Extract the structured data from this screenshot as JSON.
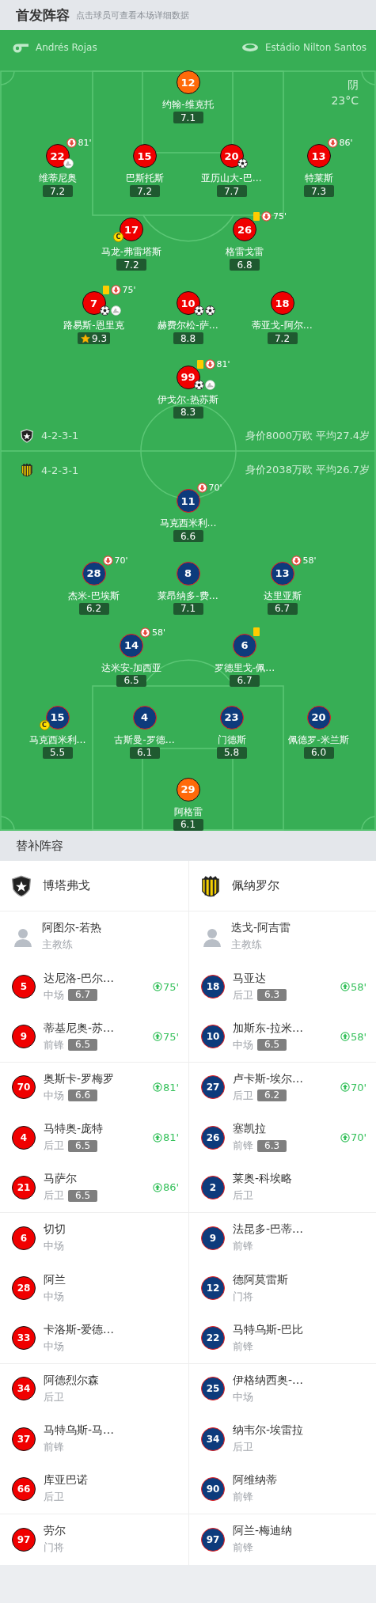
{
  "header": {
    "title": "首发阵容",
    "hint": "点击球员可查看本场详细数据"
  },
  "match_info": {
    "referee": "Andrés Rojas",
    "venue": "Estádio Nilton Santos",
    "weather": "阴",
    "temperature": "23°C"
  },
  "pitch": {
    "home": {
      "formation": "4-2-3-1",
      "summary": "身价8000万欧 平均27.4岁",
      "rows": [
        {
          "players": [
            {
              "number": "12",
              "name": "约翰-维克托",
              "rating": "7.1",
              "kind": "goalkeeper"
            }
          ]
        },
        {
          "players": [
            {
              "number": "22",
              "name": "维蒂尼奥",
              "rating": "7.2",
              "kind": "outfield",
              "events": [
                {
                  "kind": "substitution",
                  "minute": "81'"
                }
              ],
              "contributions": [
                {
                  "kind": "assist"
                }
              ]
            },
            {
              "number": "15",
              "name": "巴斯托斯",
              "rating": "7.2",
              "kind": "outfield"
            },
            {
              "number": "20",
              "name": "亚历山大-巴…",
              "rating": "7.7",
              "kind": "outfield",
              "contributions": [
                {
                  "kind": "goal"
                }
              ]
            },
            {
              "number": "13",
              "name": "特莱斯",
              "rating": "7.3",
              "kind": "outfield",
              "events": [
                {
                  "kind": "substitution",
                  "minute": "86'"
                }
              ]
            }
          ]
        },
        {
          "players": [
            {
              "number": "17",
              "name": "马龙-弗雷塔斯",
              "rating": "7.2",
              "kind": "outfield",
              "captain_mark": "C"
            },
            {
              "number": "26",
              "name": "格雷戈雷",
              "rating": "6.8",
              "kind": "outfield",
              "events": [
                {
                  "kind": "yellow_card"
                },
                {
                  "kind": "substitution",
                  "minute": "75'"
                }
              ]
            }
          ]
        },
        {
          "players": [
            {
              "number": "7",
              "name": "路易斯-恩里克",
              "rating": "9.3",
              "kind": "outfield",
              "best": true,
              "events": [
                {
                  "kind": "yellow_card"
                },
                {
                  "kind": "substitution",
                  "minute": "75'"
                }
              ],
              "contributions": [
                {
                  "kind": "goal"
                },
                {
                  "kind": "assist"
                }
              ]
            },
            {
              "number": "10",
              "name": "赫费尔松-萨…",
              "rating": "8.8",
              "kind": "outfield",
              "contributions": [
                {
                  "kind": "goal"
                },
                {
                  "kind": "goal"
                }
              ]
            },
            {
              "number": "18",
              "name": "蒂亚戈-阿尔…",
              "rating": "7.2",
              "kind": "outfield"
            }
          ]
        },
        {
          "players": [
            {
              "number": "99",
              "name": "伊戈尔-热苏斯",
              "rating": "8.3",
              "kind": "outfield",
              "events": [
                {
                  "kind": "yellow_card"
                },
                {
                  "kind": "substitution",
                  "minute": "81'"
                }
              ],
              "contributions": [
                {
                  "kind": "goal"
                },
                {
                  "kind": "assist"
                }
              ]
            }
          ]
        }
      ]
    },
    "away": {
      "formation": "4-2-3-1",
      "summary": "身价2038万欧 平均26.7岁",
      "rows": [
        {
          "players": [
            {
              "number": "11",
              "name": "马克西米利…",
              "rating": "6.6",
              "kind": "outfield",
              "events": [
                {
                  "kind": "substitution",
                  "minute": "70'"
                }
              ]
            }
          ]
        },
        {
          "players": [
            {
              "number": "28",
              "name": "杰米-巴埃斯",
              "rating": "6.2",
              "kind": "outfield",
              "events": [
                {
                  "kind": "substitution",
                  "minute": "70'"
                }
              ]
            },
            {
              "number": "8",
              "name": "莱昂纳多-费…",
              "rating": "7.1",
              "kind": "outfield"
            },
            {
              "number": "13",
              "name": "达里亚斯",
              "rating": "6.7",
              "kind": "outfield",
              "events": [
                {
                  "kind": "substitution",
                  "minute": "58'"
                }
              ]
            }
          ]
        },
        {
          "players": [
            {
              "number": "14",
              "name": "达米安-加西亚",
              "rating": "6.5",
              "kind": "outfield",
              "events": [
                {
                  "kind": "substitution",
                  "minute": "58'"
                }
              ]
            },
            {
              "number": "6",
              "name": "罗德里戈-佩…",
              "rating": "6.7",
              "kind": "outfield",
              "events": [
                {
                  "kind": "yellow_card"
                }
              ]
            }
          ]
        },
        {
          "players": [
            {
              "number": "15",
              "name": "马克西米利…",
              "rating": "5.5",
              "kind": "outfield",
              "captain_mark": "C"
            },
            {
              "number": "4",
              "name": "古斯曼-罗德…",
              "rating": "6.1",
              "kind": "outfield"
            },
            {
              "number": "23",
              "name": "门德斯",
              "rating": "5.8",
              "kind": "outfield"
            },
            {
              "number": "20",
              "name": "佩德罗-米兰斯",
              "rating": "6.0",
              "kind": "outfield"
            }
          ]
        },
        {
          "players": [
            {
              "number": "29",
              "name": "阿格雷",
              "rating": "6.1",
              "kind": "goalkeeper"
            }
          ]
        }
      ]
    }
  },
  "substitutes": {
    "title": "替补阵容",
    "teams": [
      {
        "name": "博塔弗戈",
        "kind": "home",
        "coach": {
          "name": "阿图尔-若热",
          "role": "主教练"
        },
        "players": [
          {
            "number": "5",
            "name": "达尼洛-巴尔…",
            "position": "中场",
            "rating": "6.7",
            "sub_on": "75'"
          },
          {
            "number": "9",
            "name": "蒂基尼奥-苏…",
            "position": "前锋",
            "rating": "6.5",
            "sub_on": "75'"
          },
          {
            "number": "70",
            "name": "奥斯卡-罗梅罗",
            "position": "中场",
            "rating": "6.6",
            "sub_on": "81'"
          },
          {
            "number": "4",
            "name": "马特奥-庞特",
            "position": "后卫",
            "rating": "6.5",
            "sub_on": "81'"
          },
          {
            "number": "21",
            "name": "马萨尔",
            "position": "后卫",
            "rating": "6.5",
            "sub_on": "86'"
          },
          {
            "number": "6",
            "name": "切切",
            "position": "中场"
          },
          {
            "number": "28",
            "name": "阿兰",
            "position": "中场"
          },
          {
            "number": "33",
            "name": "卡洛斯-爱德…",
            "position": "中场"
          },
          {
            "number": "34",
            "name": "阿德烈尔森",
            "position": "后卫"
          },
          {
            "number": "37",
            "name": "马特乌斯-马…",
            "position": "前锋"
          },
          {
            "number": "66",
            "name": "库亚巴诺",
            "position": "后卫"
          },
          {
            "number": "97",
            "name": "劳尔",
            "position": "门将"
          }
        ]
      },
      {
        "name": "佩纳罗尔",
        "kind": "away",
        "coach": {
          "name": "迭戈-阿吉雷",
          "role": "主教练"
        },
        "players": [
          {
            "number": "18",
            "name": "马亚达",
            "position": "后卫",
            "rating": "6.3",
            "sub_on": "58'"
          },
          {
            "number": "10",
            "name": "加斯东-拉米…",
            "position": "中场",
            "rating": "6.5",
            "sub_on": "58'"
          },
          {
            "number": "27",
            "name": "卢卡斯-埃尔…",
            "position": "后卫",
            "rating": "6.2",
            "sub_on": "70'"
          },
          {
            "number": "26",
            "name": "塞凯拉",
            "position": "前锋",
            "rating": "6.3",
            "sub_on": "70'"
          },
          {
            "number": "2",
            "name": "莱奥-科埃略",
            "position": "后卫"
          },
          {
            "number": "9",
            "name": "法昆多-巴蒂…",
            "position": "前锋"
          },
          {
            "number": "12",
            "name": "德阿莫雷斯",
            "position": "门将"
          },
          {
            "number": "22",
            "name": "马特乌斯-巴比",
            "position": "前锋"
          },
          {
            "number": "25",
            "name": "伊格纳西奥-…",
            "position": "中场"
          },
          {
            "number": "34",
            "name": "纳韦尔-埃雷拉",
            "position": "后卫"
          },
          {
            "number": "90",
            "name": "阿维纳蒂",
            "position": "前锋"
          },
          {
            "number": "97",
            "name": "阿兰-梅迪纳",
            "position": "前锋"
          }
        ]
      }
    ]
  }
}
